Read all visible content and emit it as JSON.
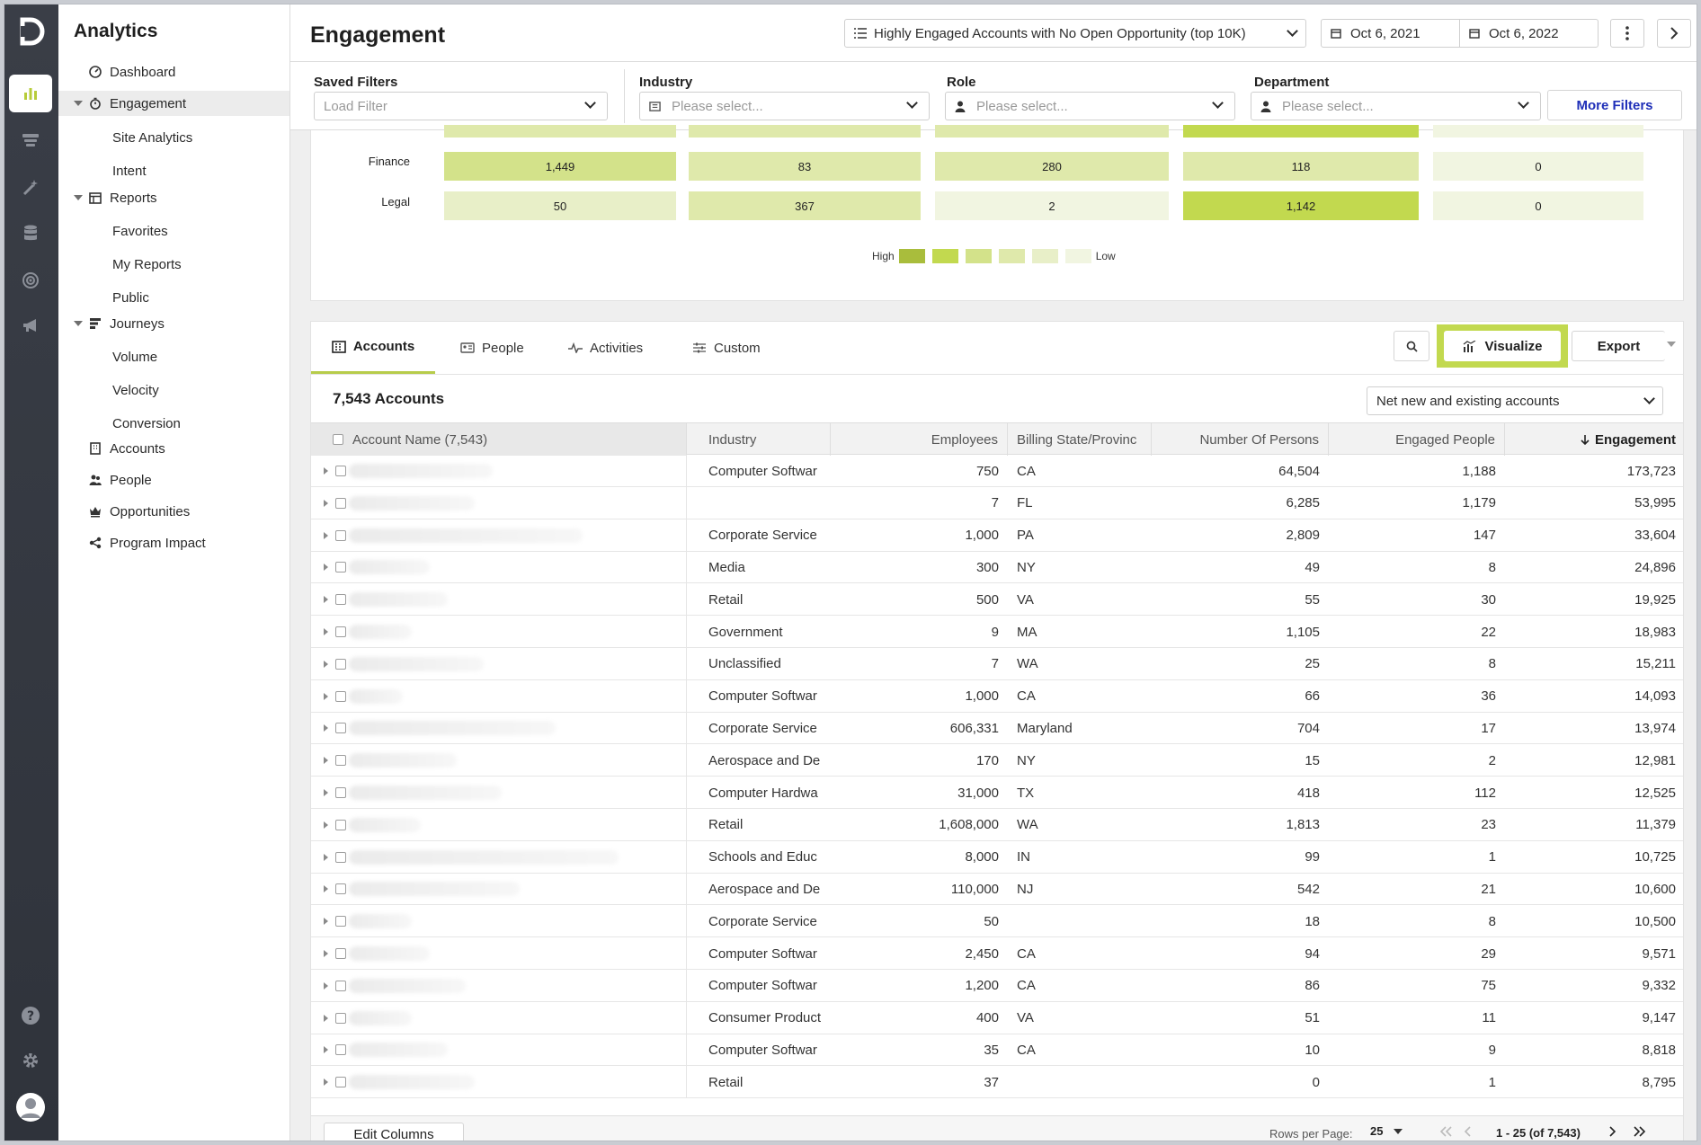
{
  "app": {
    "title": "Analytics"
  },
  "header": {
    "title": "Engagement",
    "segment": "Highly Engaged Accounts with No Open Opportunity (top 10K)",
    "date_from": "Oct 6, 2021",
    "date_to": "Oct 6, 2022"
  },
  "sidebar": {
    "items": [
      {
        "label": "Dashboard"
      },
      {
        "label": "Engagement"
      },
      {
        "label": "Site Analytics"
      },
      {
        "label": "Intent"
      },
      {
        "label": "Reports"
      },
      {
        "label": "Favorites"
      },
      {
        "label": "My Reports"
      },
      {
        "label": "Public"
      },
      {
        "label": "Journeys"
      },
      {
        "label": "Volume"
      },
      {
        "label": "Velocity"
      },
      {
        "label": "Conversion"
      },
      {
        "label": "Accounts"
      },
      {
        "label": "People"
      },
      {
        "label": "Opportunities"
      },
      {
        "label": "Program Impact"
      }
    ]
  },
  "filters": {
    "saved": {
      "label": "Saved Filters",
      "placeholder": "Load Filter"
    },
    "industry": {
      "label": "Industry",
      "placeholder": "Please select..."
    },
    "role": {
      "label": "Role",
      "placeholder": "Please select..."
    },
    "department": {
      "label": "Department",
      "placeholder": "Please select..."
    },
    "more": "More Filters"
  },
  "heatmap": {
    "rows": [
      {
        "label": "Finance",
        "values": [
          "1,449",
          "83",
          "280",
          "118",
          "0"
        ]
      },
      {
        "label": "Legal",
        "values": [
          "50",
          "367",
          "2",
          "1,142",
          "0"
        ]
      }
    ],
    "legend_high": "High",
    "legend_low": "Low",
    "legend_colors": [
      "#a9bd3c",
      "#c2d94f",
      "#d3e28a",
      "#dfe9ab",
      "#e8efc8",
      "#f1f5e1"
    ]
  },
  "tabs": {
    "accounts": "Accounts",
    "people": "People",
    "activities": "Activities",
    "custom": "Custom"
  },
  "actions": {
    "visualize": "Visualize",
    "export": "Export"
  },
  "summary": {
    "count_label": "7,543 Accounts",
    "scope": "Net new and existing accounts"
  },
  "table": {
    "headers": {
      "name": "Account Name (7,543)",
      "industry": "Industry",
      "employees": "Employees",
      "state": "Billing State/Provinc",
      "persons": "Number Of Persons",
      "engaged": "Engaged People",
      "engagement": "Engagement"
    },
    "rows": [
      {
        "industry": "Computer Softwar",
        "employees": "750",
        "state": "CA",
        "persons": "64,504",
        "engaged": "1,188",
        "engagement": "173,723"
      },
      {
        "industry": "",
        "employees": "7",
        "state": "FL",
        "persons": "6,285",
        "engaged": "1,179",
        "engagement": "53,995"
      },
      {
        "industry": "Corporate Service",
        "employees": "1,000",
        "state": "PA",
        "persons": "2,809",
        "engaged": "147",
        "engagement": "33,604"
      },
      {
        "industry": "Media",
        "employees": "300",
        "state": "NY",
        "persons": "49",
        "engaged": "8",
        "engagement": "24,896"
      },
      {
        "industry": "Retail",
        "employees": "500",
        "state": "VA",
        "persons": "55",
        "engaged": "30",
        "engagement": "19,925"
      },
      {
        "industry": "Government",
        "employees": "9",
        "state": "MA",
        "persons": "1,105",
        "engaged": "22",
        "engagement": "18,983"
      },
      {
        "industry": "Unclassified",
        "employees": "7",
        "state": "WA",
        "persons": "25",
        "engaged": "8",
        "engagement": "15,211"
      },
      {
        "industry": "Computer Softwar",
        "employees": "1,000",
        "state": "CA",
        "persons": "66",
        "engaged": "36",
        "engagement": "14,093"
      },
      {
        "industry": "Corporate Service",
        "employees": "606,331",
        "state": "Maryland",
        "persons": "704",
        "engaged": "17",
        "engagement": "13,974"
      },
      {
        "industry": "Aerospace and De",
        "employees": "170",
        "state": "NY",
        "persons": "15",
        "engaged": "2",
        "engagement": "12,981"
      },
      {
        "industry": "Computer Hardwa",
        "employees": "31,000",
        "state": "TX",
        "persons": "418",
        "engaged": "112",
        "engagement": "12,525"
      },
      {
        "industry": "Retail",
        "employees": "1,608,000",
        "state": "WA",
        "persons": "1,813",
        "engaged": "23",
        "engagement": "11,379"
      },
      {
        "industry": "Schools and Educ",
        "employees": "8,000",
        "state": "IN",
        "persons": "99",
        "engaged": "1",
        "engagement": "10,725"
      },
      {
        "industry": "Aerospace and De",
        "employees": "110,000",
        "state": "NJ",
        "persons": "542",
        "engaged": "21",
        "engagement": "10,600"
      },
      {
        "industry": "Corporate Service",
        "employees": "50",
        "state": "",
        "persons": "18",
        "engaged": "8",
        "engagement": "10,500"
      },
      {
        "industry": "Computer Softwar",
        "employees": "2,450",
        "state": "CA",
        "persons": "94",
        "engaged": "29",
        "engagement": "9,571"
      },
      {
        "industry": "Computer Softwar",
        "employees": "1,200",
        "state": "CA",
        "persons": "86",
        "engaged": "75",
        "engagement": "9,332"
      },
      {
        "industry": "Consumer Product",
        "employees": "400",
        "state": "VA",
        "persons": "51",
        "engaged": "11",
        "engagement": "9,147"
      },
      {
        "industry": "Computer Softwar",
        "employees": "35",
        "state": "CA",
        "persons": "10",
        "engaged": "9",
        "engagement": "8,818"
      },
      {
        "industry": "Retail",
        "employees": "37",
        "state": "",
        "persons": "0",
        "engaged": "1",
        "engagement": "8,795"
      }
    ]
  },
  "footer": {
    "edit_columns": "Edit Columns",
    "rows_per_page_label": "Rows per Page:",
    "rows_per_page": "25",
    "range": "1 - 25 (of 7,543)"
  },
  "colors": {
    "accent": "#c2d94f",
    "accent_dark": "#a9bd3c",
    "link": "#1f2fb8"
  }
}
